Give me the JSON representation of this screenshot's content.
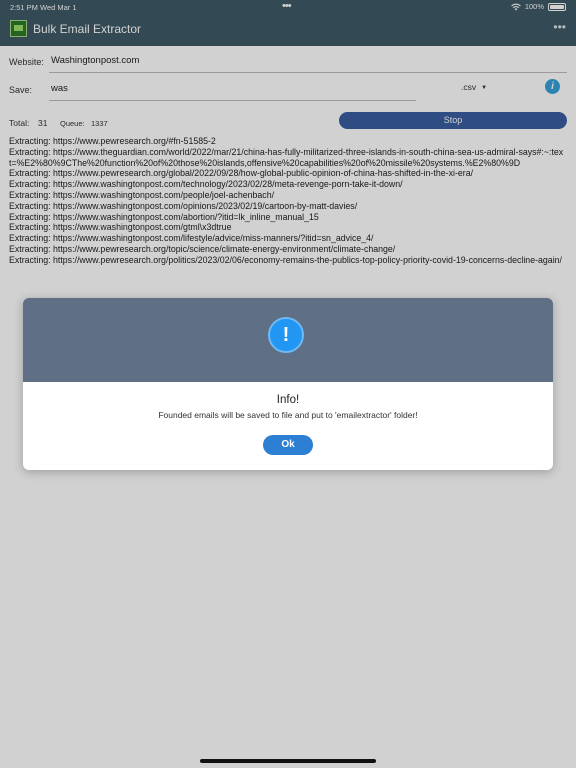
{
  "status_bar": {
    "time": "2:51 PM",
    "date": "Wed Mar 1",
    "dots": "•••",
    "battery": "100%"
  },
  "app": {
    "title": "Bulk Email Extractor",
    "menu": "•••"
  },
  "form": {
    "website_label": "Website:",
    "website_value": "Washingtonpost.com",
    "save_label": "Save:",
    "save_value": "was",
    "format_selected": ".csv",
    "info_glyph": "i",
    "stop_label": "Stop"
  },
  "stats": {
    "total_label": "Total:",
    "total_value": "31",
    "queue_label": "Queue:",
    "queue_value": "1337"
  },
  "log": [
    "Extracting: https://www.pewresearch.org/#fn-51585-2",
    "Extracting: https://www.theguardian.com/world/2022/mar/21/china-has-fully-militarized-three-islands-in-south-china-sea-us-admiral-says#:~:text=%E2%80%9CThe%20function%20of%20those%20islands,offensive%20capabilities%20of%20missile%20systems.%E2%80%9D",
    "Extracting: https://www.pewresearch.org/global/2022/09/28/how-global-public-opinion-of-china-has-shifted-in-the-xi-era/",
    "Extracting: https://www.washingtonpost.com/technology/2023/02/28/meta-revenge-porn-take-it-down/",
    "Extracting: https://www.washingtonpost.com/people/joel-achenbach/",
    "Extracting: https://www.washingtonpost.com/opinions/2023/02/19/cartoon-by-matt-davies/",
    "Extracting: https://www.washingtonpost.com/abortion/?itid=lk_inline_manual_15",
    "Extracting: https://www.washingtonpost.com/gtml\\x3dtrue",
    "Extracting: https://www.washingtonpost.com/lifestyle/advice/miss-manners/?itid=sn_advice_4/",
    "Extracting: https://www.pewresearch.org/topic/science/climate-energy-environment/climate-change/",
    "Extracting: https://www.pewresearch.org/politics/2023/02/06/economy-remains-the-publics-top-policy-priority-covid-19-concerns-decline-again/"
  ],
  "dialog": {
    "icon_glyph": "!",
    "title": "Info!",
    "message": "Founded emails will be saved to file and put to 'emailextractor' folder!",
    "ok_label": "Ok"
  }
}
